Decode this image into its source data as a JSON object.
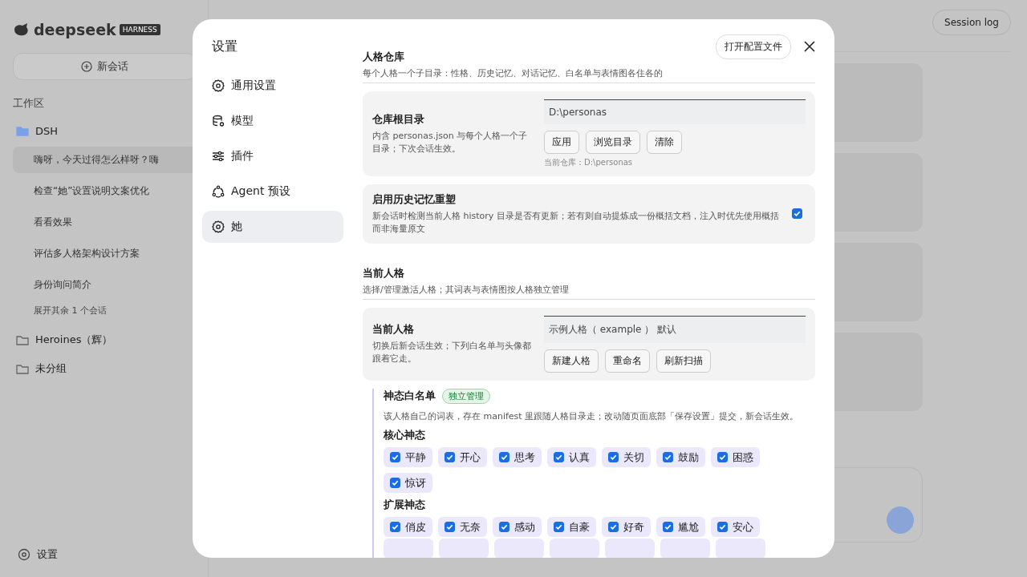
{
  "background": {
    "logo": "deepseek",
    "badge": "HARNESS",
    "new_chat": "新会话",
    "workspace_label": "工作区",
    "groups": [
      {
        "name": "DSH",
        "expanded": true,
        "sessions": [
          {
            "title": "嗨呀，今天过得怎么样呀？嗨",
            "selected": true
          },
          {
            "title": "检查“她”设置说明文案优化",
            "selected": false
          },
          {
            "title": "看看效果",
            "selected": false
          },
          {
            "title": "评估多人格架构设计方案",
            "selected": false
          },
          {
            "title": "身份询问简介",
            "selected": false
          }
        ],
        "more": "展开其余 1 个会话"
      },
      {
        "name": "Heroines（辉）",
        "expanded": false
      },
      {
        "name": "未分组",
        "expanded": false
      }
    ],
    "settings": "设置",
    "session_log": "Session log"
  },
  "dialog": {
    "title": "设置",
    "open_config": "打开配置文件",
    "nav": [
      {
        "label": "通用设置",
        "selected": false
      },
      {
        "label": "模型",
        "selected": false
      },
      {
        "label": "插件",
        "selected": false
      },
      {
        "label": "Agent 预设",
        "selected": false
      },
      {
        "label": "她",
        "selected": true
      }
    ],
    "sections": [
      {
        "title": "人格仓库",
        "subtitle": "每个人格一个子目录：性格、历史记忆、对话记忆、白名单与表情图各住各的",
        "cards": [
          {
            "kind": "path",
            "label": "仓库根目录",
            "description": "内含 personas.json 与每个人格一个子目录；下次会话生效。",
            "value": "D:\\personas",
            "buttons": [
              "应用",
              "浏览目录",
              "清除"
            ],
            "note": "当前仓库：D:\\personas"
          },
          {
            "kind": "toggle",
            "label": "启用历史记忆重塑",
            "description": "新会话时检测当前人格 history 目录是否有更新；若有则自动提炼成一份概括文档，注入时优先使用概括而非海量原文",
            "checked": true
          }
        ]
      },
      {
        "title": "当前人格",
        "subtitle": "选择/管理激活人格；其词表与表情图按人格独立管理",
        "cards": [
          {
            "kind": "select",
            "label": "当前人格",
            "description": "切换后新会话生效；下列白名单与头像都跟着它走。",
            "value": "示例人格（ example ） 默认",
            "buttons": [
              "新建人格",
              "重命名",
              "刷新扫描"
            ]
          }
        ]
      }
    ],
    "whitelist": {
      "title": "神态白名单",
      "tag": "独立管理",
      "description": "该人格自己的词表，存在 manifest 里跟随人格目录走；改动随页面底部「保存设置」提交，新会话生效。",
      "groups": [
        {
          "name": "核心神态",
          "items": [
            {
              "label": "平静",
              "checked": true
            },
            {
              "label": "开心",
              "checked": true
            },
            {
              "label": "思考",
              "checked": true
            },
            {
              "label": "认真",
              "checked": true
            },
            {
              "label": "关切",
              "checked": true
            },
            {
              "label": "鼓励",
              "checked": true
            },
            {
              "label": "困惑",
              "checked": true
            },
            {
              "label": "惊讶",
              "checked": true
            }
          ]
        },
        {
          "name": "扩展神态",
          "items": [
            {
              "label": "俏皮",
              "checked": true
            },
            {
              "label": "无奈",
              "checked": true
            },
            {
              "label": "感动",
              "checked": true
            },
            {
              "label": "自豪",
              "checked": true
            },
            {
              "label": "好奇",
              "checked": true
            },
            {
              "label": "尴尬",
              "checked": true
            },
            {
              "label": "安心",
              "checked": true
            }
          ]
        }
      ]
    }
  }
}
